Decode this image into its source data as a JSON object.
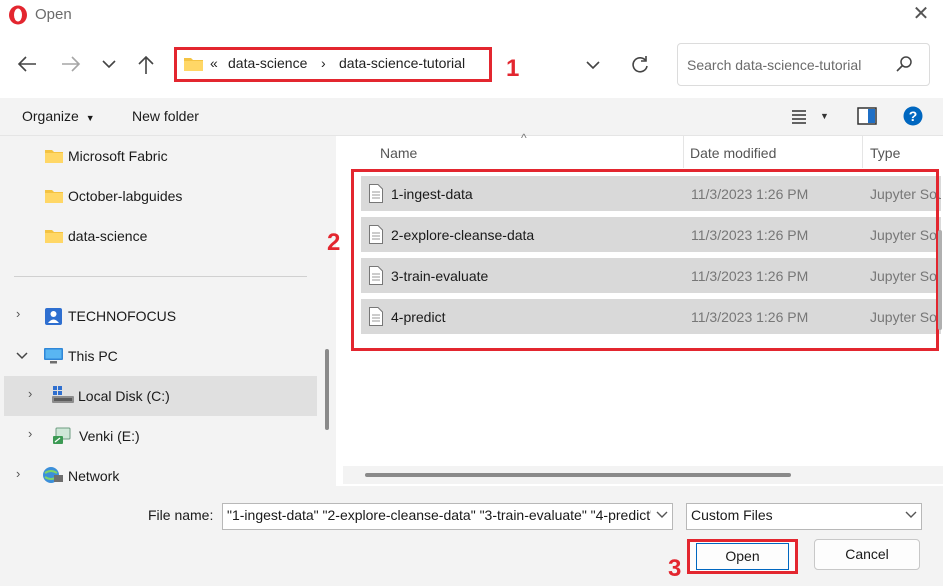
{
  "window": {
    "title": "Open",
    "close_glyph": "✕"
  },
  "nav": {
    "back_icon": "back-arrow-icon",
    "forward_icon": "forward-arrow-icon",
    "recent_icon": "chevron-down-icon",
    "up_icon": "up-arrow-icon",
    "overflow_glyph": "«",
    "breadcrumbs": [
      "data-science",
      "data-science-tutorial"
    ],
    "separator": "›",
    "refresh_icon": "refresh-icon"
  },
  "search": {
    "placeholder": "Search data-science-tutorial"
  },
  "toolbar": {
    "organize_label": "Organize",
    "new_folder_label": "New folder"
  },
  "sidebar": {
    "folders": [
      "Microsoft Fabric",
      "October-labguides",
      "data-science"
    ],
    "locations": [
      {
        "label": "TECHNOFOCUS",
        "icon": "user-folder-icon"
      },
      {
        "label": "This PC",
        "icon": "monitor-icon"
      },
      {
        "label": "Local Disk (C:)",
        "icon": "local-disk-icon"
      },
      {
        "label": "Venki (E:)",
        "icon": "drive-icon"
      },
      {
        "label": "Network",
        "icon": "network-icon"
      }
    ]
  },
  "columns": {
    "name": "Name",
    "date_modified": "Date modified",
    "type": "Type"
  },
  "files": [
    {
      "name": "1-ingest-data",
      "date": "11/3/2023 1:26 PM",
      "type": "Jupyter Source File"
    },
    {
      "name": "2-explore-cleanse-data",
      "date": "11/3/2023 1:26 PM",
      "type": "Jupyter Source File"
    },
    {
      "name": "3-train-evaluate",
      "date": "11/3/2023 1:26 PM",
      "type": "Jupyter Source File"
    },
    {
      "name": "4-predict",
      "date": "11/3/2023 1:26 PM",
      "type": "Jupyter Source File"
    }
  ],
  "footer": {
    "file_name_label": "File name:",
    "file_name_value": "\"1-ingest-data\" \"2-explore-cleanse-data\" \"3-train-evaluate\" \"4-predict\"",
    "file_type_value": "Custom Files",
    "open_label": "Open",
    "cancel_label": "Cancel"
  },
  "callouts": [
    "1",
    "2",
    "3"
  ],
  "colors": {
    "accent_red": "#e3262f",
    "selection_gray": "#d9d9d9",
    "help_blue": "#0067c0"
  }
}
